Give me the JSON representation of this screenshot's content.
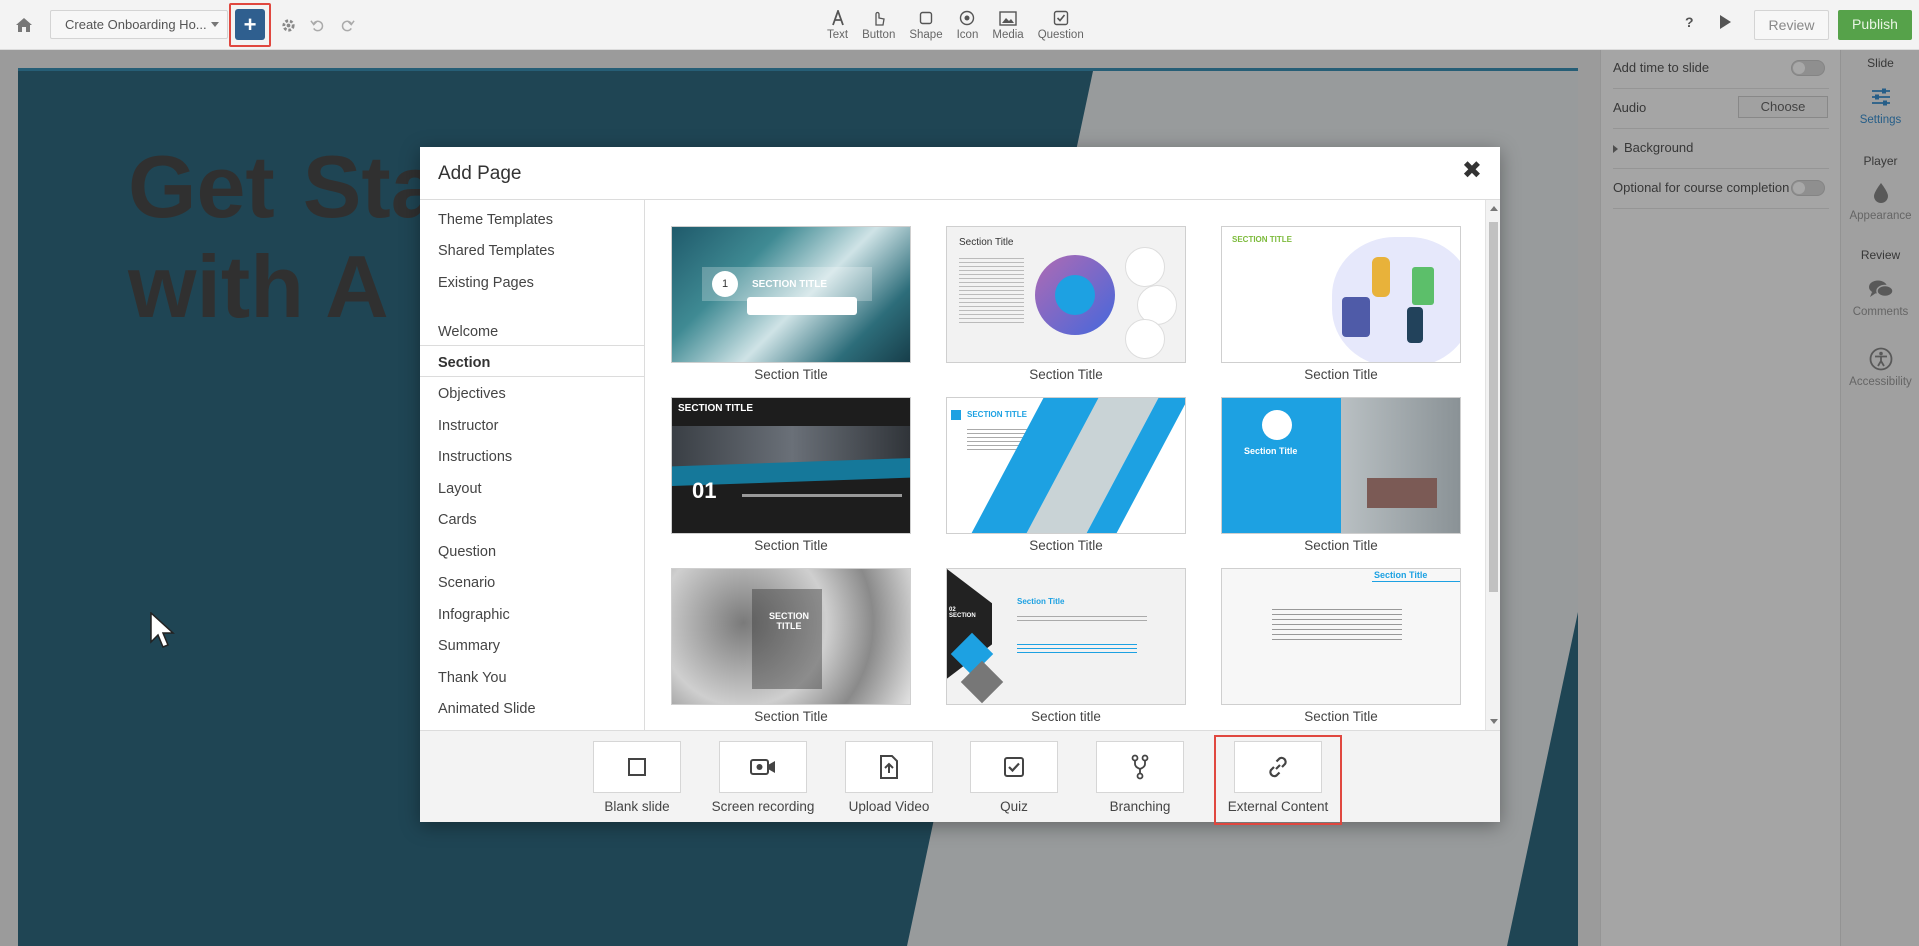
{
  "topbar": {
    "course_name": "Create Onboarding Ho...",
    "insert_tools": [
      {
        "icon": "text-icon",
        "label": "Text"
      },
      {
        "icon": "button-icon",
        "label": "Button"
      },
      {
        "icon": "shape-icon",
        "label": "Shape"
      },
      {
        "icon": "icon-icon",
        "label": "Icon"
      },
      {
        "icon": "media-icon",
        "label": "Media"
      },
      {
        "icon": "question-icon",
        "label": "Question"
      }
    ],
    "help_label": "?",
    "review_label": "Review",
    "publish_label": "Publish",
    "publish_color": "#56a24a",
    "add_button_color": "#2f5f8f"
  },
  "slide": {
    "title_line1": "Get",
    "title_line1b": "Started",
    "title_line2": "with A",
    "background_color": "#2f6a80"
  },
  "right_panel": {
    "add_time_label": "Add time to slide",
    "audio_label": "Audio",
    "choose_label": "Choose",
    "background_label": "Background",
    "optional_label": "Optional for course completion"
  },
  "right_bar": {
    "slide_head": "Slide",
    "settings_label": "Settings",
    "player_head": "Player",
    "appearance_label": "Appearance",
    "review_head": "Review",
    "comments_label": "Comments",
    "accessibility_label": "Accessibility"
  },
  "modal": {
    "title": "Add Page",
    "close": "✖",
    "menu_top": [
      "Theme Templates",
      "Shared Templates",
      "Existing Pages"
    ],
    "menu_categories": [
      "Welcome",
      "Section",
      "Objectives",
      "Instructor",
      "Instructions",
      "Layout",
      "Cards",
      "Question",
      "Scenario",
      "Infographic",
      "Summary",
      "Thank You",
      "Animated Slide"
    ],
    "active_category": "Section",
    "templates": [
      {
        "label": "Section Title",
        "thumb_text": "SECTION TITLE",
        "number": "1"
      },
      {
        "label": "Section Title",
        "thumb_text": "Section Title"
      },
      {
        "label": "Section Title",
        "thumb_text": "SECTION TITLE"
      },
      {
        "label": "Section Title",
        "thumb_text": "SECTION TITLE",
        "number": "01"
      },
      {
        "label": "Section Title",
        "thumb_text": "SECTION TITLE"
      },
      {
        "label": "Section Title",
        "thumb_text": "Section Title"
      },
      {
        "label": "Section Title",
        "thumb_text": "SECTION TITLE"
      },
      {
        "label": "Section title",
        "thumb_text": "Section Title",
        "number": "02 SECTION"
      },
      {
        "label": "Section Title",
        "thumb_text": "Section Title"
      }
    ],
    "footer_tools": [
      {
        "icon": "square-icon",
        "label": "Blank slide"
      },
      {
        "icon": "video-camera-icon",
        "label": "Screen recording"
      },
      {
        "icon": "upload-file-icon",
        "label": "Upload Video"
      },
      {
        "icon": "checkbox-icon",
        "label": "Quiz"
      },
      {
        "icon": "branch-icon",
        "label": "Branching"
      },
      {
        "icon": "link-icon",
        "label": "External Content"
      }
    ],
    "highlight_color": "#e0473f",
    "accent_blue": "#1da1e2"
  }
}
